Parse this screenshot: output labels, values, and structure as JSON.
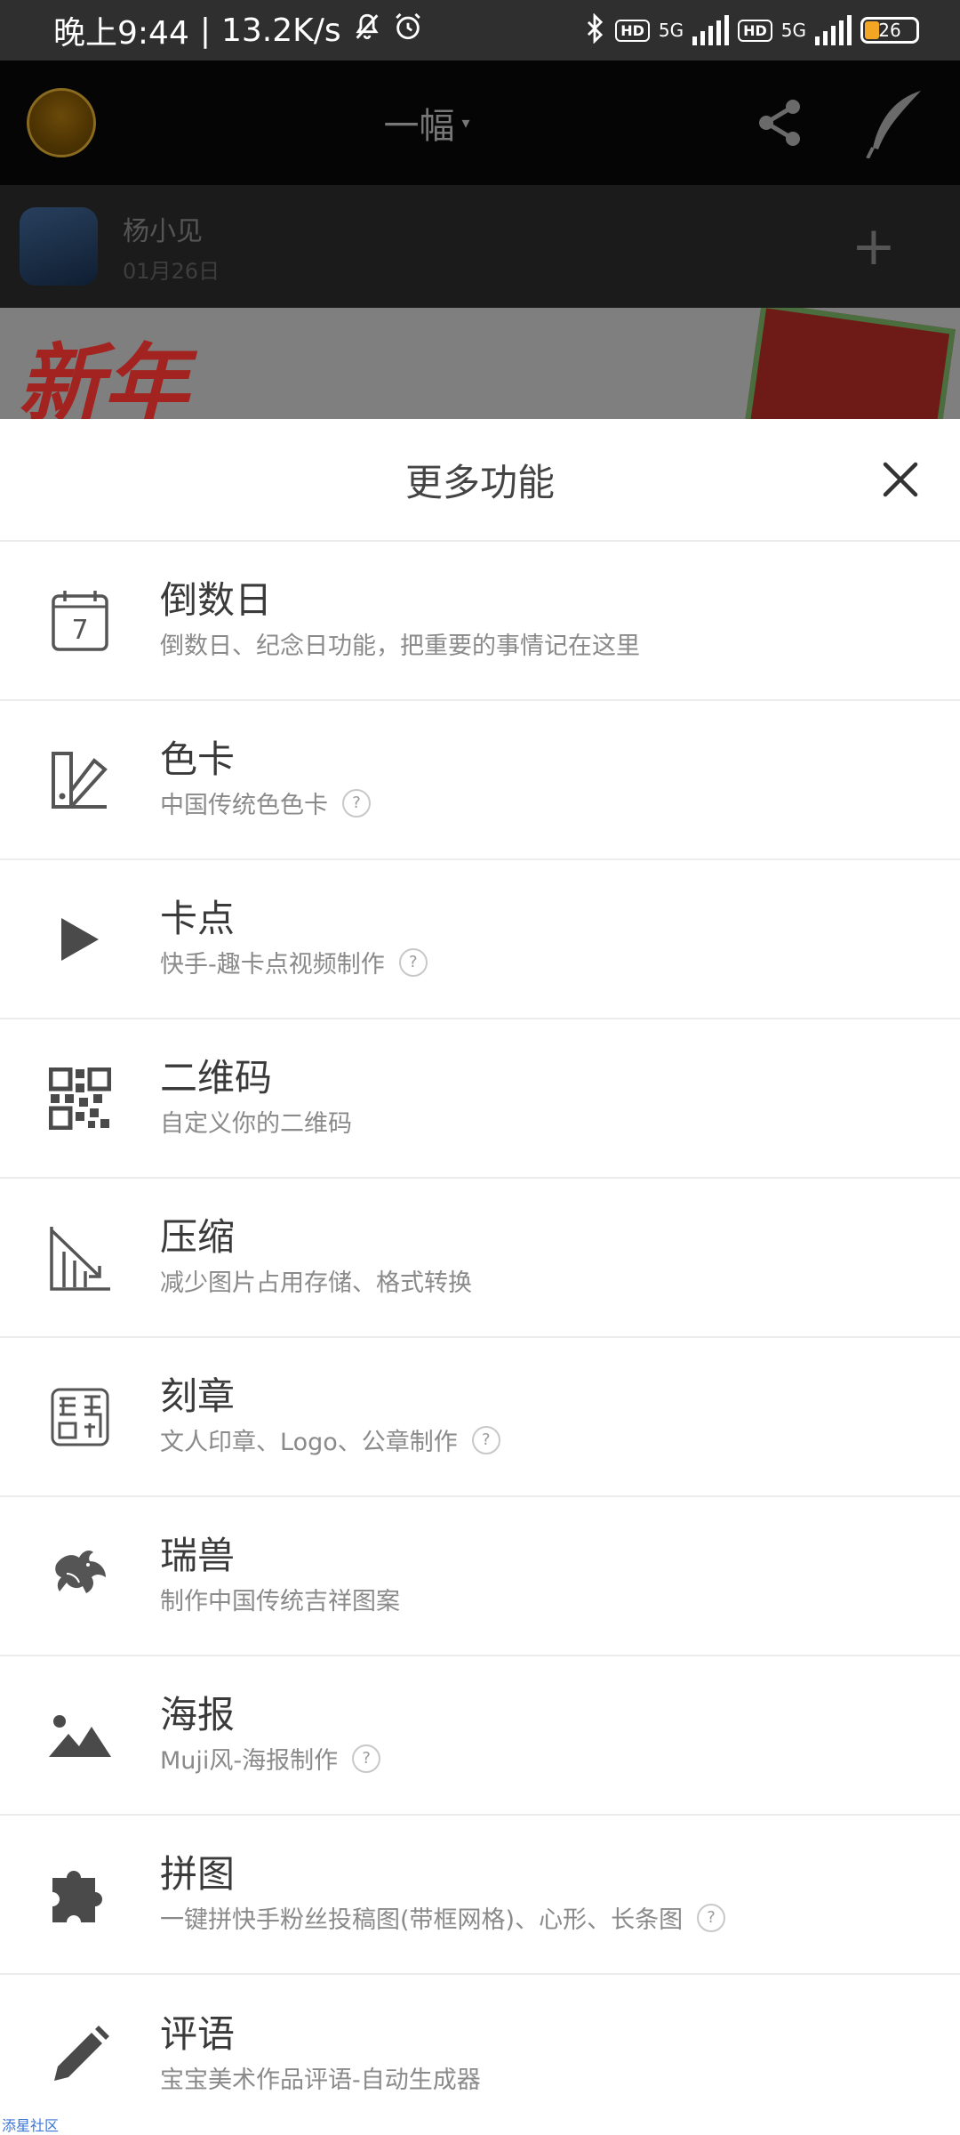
{
  "status_bar": {
    "time": "晚上9:44",
    "speed": "13.2K/s",
    "network_1": "5G",
    "network_2": "5G",
    "hd_label": "HD",
    "battery": "26"
  },
  "app_bar": {
    "title": "一幅",
    "title_caret": "▾"
  },
  "post": {
    "author": "杨小见",
    "date": "01月26日",
    "add": "+"
  },
  "banner": {
    "text": "新年"
  },
  "sheet": {
    "title": "更多功能",
    "help_symbol": "?",
    "items": [
      {
        "title": "倒数日",
        "subtitle": "倒数日、纪念日功能，把重要的事情记在这里",
        "icon": "calendar-icon",
        "help": false
      },
      {
        "title": "色卡",
        "subtitle": "中国传统色色卡",
        "icon": "color-card-icon",
        "help": true
      },
      {
        "title": "卡点",
        "subtitle": "快手-趣卡点视频制作",
        "icon": "play-icon",
        "help": true
      },
      {
        "title": "二维码",
        "subtitle": "自定义你的二维码",
        "icon": "qr-code-icon",
        "help": false
      },
      {
        "title": "压缩",
        "subtitle": "减少图片占用存储、格式转换",
        "icon": "compress-icon",
        "help": false
      },
      {
        "title": "刻章",
        "subtitle": "文人印章、Logo、公章制作",
        "icon": "seal-icon",
        "help": true
      },
      {
        "title": "瑞兽",
        "subtitle": "制作中国传统吉祥图案",
        "icon": "auspicious-beast-icon",
        "help": false
      },
      {
        "title": "海报",
        "subtitle": "Muji风-海报制作",
        "icon": "poster-icon",
        "help": true
      },
      {
        "title": "拼图",
        "subtitle": "一键拼快手粉丝投稿图(带框网格)、心形、长条图",
        "icon": "puzzle-icon",
        "help": true
      },
      {
        "title": "评语",
        "subtitle": "宝宝美术作品评语-自动生成器",
        "icon": "pencil-icon",
        "help": false
      }
    ]
  },
  "footer": {
    "link": "添星社区"
  }
}
